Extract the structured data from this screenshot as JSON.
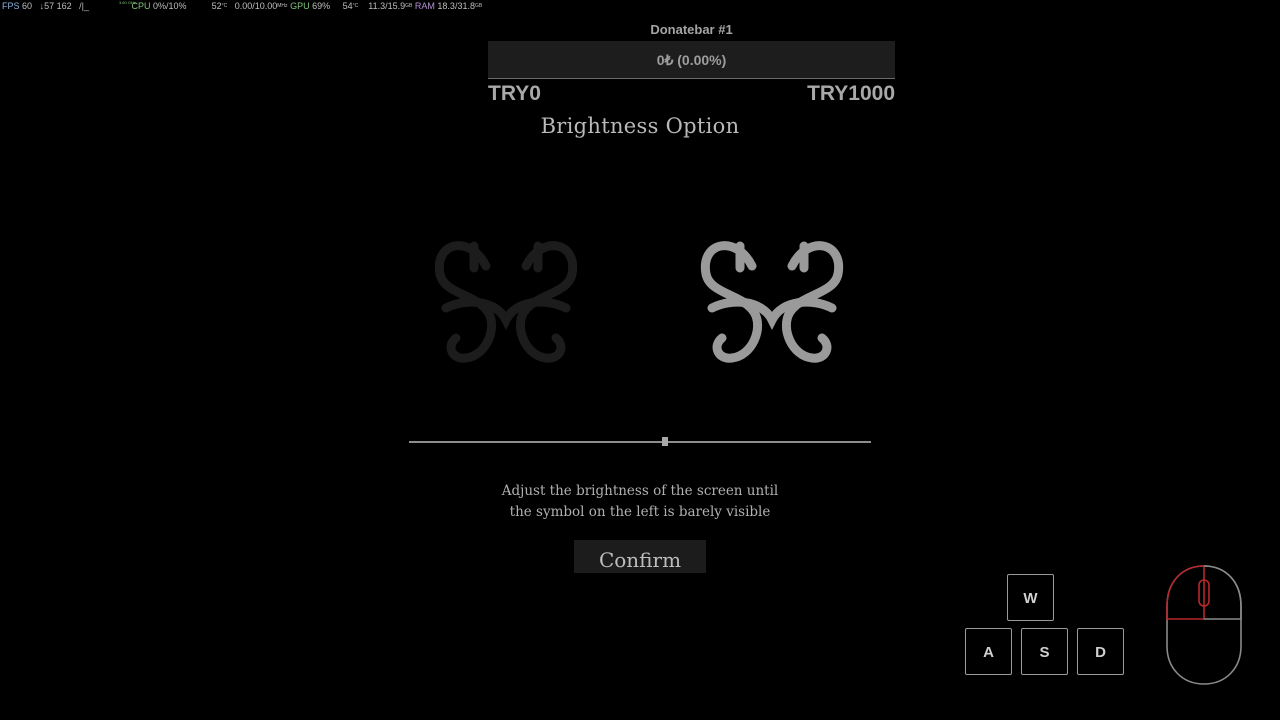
{
  "perf_overlay": {
    "fps_label": "FPS",
    "fps_value": "60",
    "frametime": "↓57 162",
    "graph": "/|_",
    "cpu_tiny": "3.60 GHz",
    "cpu_label": "CPU",
    "cpu_value": "0%/10%",
    "cpu_temp": "52",
    "temp_unit": "°C",
    "cpu_clock": "0.00/10.00",
    "clock_unit": "MHz",
    "gpu_label": "GPU",
    "gpu_value": "69%",
    "gpu_temp": "54",
    "vram": "11.3/15.9",
    "mem_unit": "GB",
    "ram_label": "RAM",
    "ram_value": "18.3/31.8",
    "colors": {
      "fps": "#8fb4e0",
      "cpu": "#7ec47e",
      "gpu": "#7ec47e",
      "ram": "#b48fd6"
    }
  },
  "donatebar": {
    "title": "Donatebar #1",
    "progress_text": "0₺ (0.00%)",
    "progress_fraction": 0.0,
    "min_label": "TRY0",
    "max_label": "TRY1000",
    "fill_color": "#3a7a3a"
  },
  "brightness": {
    "title": "Brightness Option",
    "symbol_icon": "ornamental-crest-icon",
    "slider_value": 0.555,
    "instruction_line1": "Adjust the brightness of the screen until",
    "instruction_line2": "the symbol on the left is barely visible",
    "confirm_label": "Confirm"
  },
  "input_overlay": {
    "keys": {
      "w": "W",
      "a": "A",
      "s": "S",
      "d": "D"
    },
    "mouse_icon": "mouse-icon",
    "highlight_color": "#b82828"
  }
}
